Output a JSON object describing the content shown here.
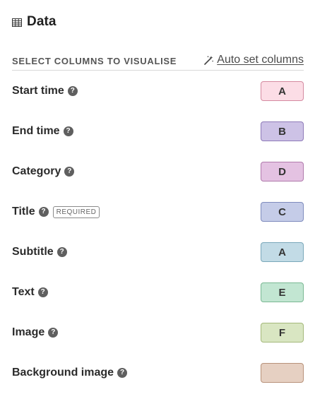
{
  "header": {
    "title": "Data",
    "icon": "table-grid-icon"
  },
  "subheader": {
    "label": "SELECT COLUMNS TO VISUALISE",
    "auto_set_label": "Auto set columns",
    "auto_set_icon": "magic-wand-icon"
  },
  "help_glyph": "?",
  "required_label": "REQUIRED",
  "fields": [
    {
      "name": "Start time",
      "column": "A",
      "color": "#fcdde6",
      "border": "#d48aa0"
    },
    {
      "name": "End time",
      "column": "B",
      "color": "#cdc2e6",
      "border": "#8e7ab8"
    },
    {
      "name": "Category",
      "column": "D",
      "color": "#e4c2e2",
      "border": "#b07aac"
    },
    {
      "name": "Title",
      "column": "C",
      "color": "#c5cce8",
      "border": "#7e8bbd",
      "required": true
    },
    {
      "name": "Subtitle",
      "column": "A",
      "color": "#c2dbe6",
      "border": "#7aa8ba"
    },
    {
      "name": "Text",
      "column": "E",
      "color": "#c2e6d2",
      "border": "#7ab893"
    },
    {
      "name": "Image",
      "column": "F",
      "color": "#d9e6c2",
      "border": "#a4b87a"
    },
    {
      "name": "Background image",
      "column": "",
      "color": "#e6d0c2",
      "border": "#b8927a"
    }
  ]
}
